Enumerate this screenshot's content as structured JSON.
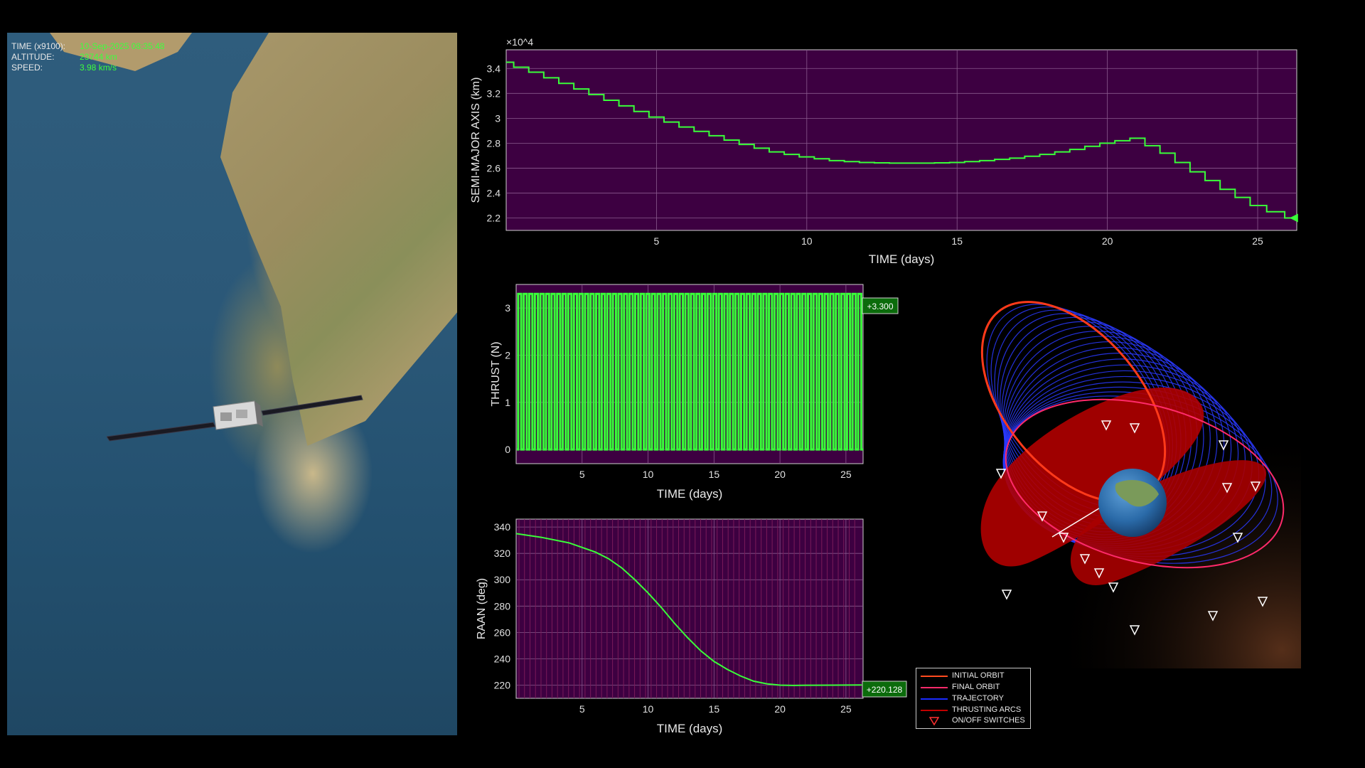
{
  "hud": {
    "time_label": "TIME (x9100):",
    "time_value": "10-Sep-2025 08:35:48",
    "altitude_label": "ALTITUDE:",
    "altitude_value": "23744 km",
    "speed_label": "SPEED:",
    "speed_value": "3.98 km/s"
  },
  "colors": {
    "plot_bg": "#3d0041",
    "series": "#39ff39",
    "initial_orbit": "#ff4b1f",
    "final_orbit": "#ff2a6a",
    "trajectory": "#1a2bff",
    "thrusting_arcs": "#c10000"
  },
  "legend": {
    "items": [
      {
        "label": "INITIAL ORBIT",
        "color": "#ff4b1f",
        "marker": "line"
      },
      {
        "label": "FINAL ORBIT",
        "color": "#ff2a6a",
        "marker": "line"
      },
      {
        "label": "TRAJECTORY",
        "color": "#1a2bff",
        "marker": "line"
      },
      {
        "label": "THRUSTING ARCS",
        "color": "#c10000",
        "marker": "line"
      },
      {
        "label": "ON/OFF SWITCHES",
        "color": "#ff3030",
        "marker": "triangle-down"
      }
    ]
  },
  "chart_data": [
    {
      "type": "line",
      "id": "sma",
      "xlabel": "TIME (days)",
      "ylabel": "SEMI-MAJOR AXIS (km)",
      "y_exponent": "×10^4",
      "xlim": [
        0,
        26.3
      ],
      "ylim": [
        2.1,
        3.55
      ],
      "xticks": [
        5,
        10,
        15,
        20,
        25
      ],
      "yticks": [
        2.2,
        2.4,
        2.6,
        2.8,
        3.0,
        3.2,
        3.4
      ],
      "ytick_labels": [
        "2.2",
        "2.4",
        "2.6",
        "2.8",
        "3",
        "3.2",
        "3.4"
      ],
      "grid": true,
      "series": [
        {
          "x": [
            0,
            1,
            2,
            3,
            4,
            5,
            6,
            7,
            8,
            9,
            10,
            11,
            12,
            13,
            14,
            15,
            16,
            17,
            18,
            19,
            20,
            21,
            22,
            23,
            24,
            25,
            26.2
          ],
          "y": [
            3.45,
            3.37,
            3.28,
            3.19,
            3.1,
            3.01,
            2.93,
            2.86,
            2.79,
            2.73,
            2.69,
            2.66,
            2.645,
            2.64,
            2.64,
            2.645,
            2.66,
            2.68,
            2.71,
            2.75,
            2.8,
            2.84,
            2.72,
            2.57,
            2.43,
            2.3,
            2.2
          ]
        }
      ],
      "endpoint_marker": {
        "x": 26.2,
        "y": 2.2
      }
    },
    {
      "type": "line",
      "id": "thrust",
      "xlabel": "TIME (days)",
      "ylabel": "THRUST (N)",
      "xlim": [
        0,
        26.3
      ],
      "ylim": [
        -0.3,
        3.5
      ],
      "xticks": [
        5,
        10,
        15,
        20,
        25
      ],
      "yticks": [
        0,
        1,
        2,
        3
      ],
      "grid": true,
      "on_value": 3.3,
      "off_value": 0,
      "pulse_count": 62,
      "data_label": "+3.300"
    },
    {
      "type": "line",
      "id": "raan",
      "xlabel": "TIME (days)",
      "ylabel": "RAAN (deg)",
      "xlim": [
        0,
        26.3
      ],
      "ylim": [
        210,
        346
      ],
      "xticks": [
        5,
        10,
        15,
        20,
        25
      ],
      "yticks": [
        220,
        240,
        260,
        280,
        300,
        320,
        340
      ],
      "grid": true,
      "series": [
        {
          "x": [
            0,
            2,
            4,
            6,
            7,
            8,
            9,
            10,
            11,
            12,
            13,
            14,
            15,
            16,
            17,
            18,
            19,
            20,
            21,
            22,
            24,
            26.2
          ],
          "y": [
            335,
            332,
            328,
            321,
            316,
            309,
            300,
            290,
            279,
            267,
            256,
            246,
            238,
            232,
            227,
            223,
            221,
            220,
            219.8,
            219.9,
            220.0,
            220.128
          ]
        }
      ],
      "data_label": "+220.128"
    }
  ]
}
